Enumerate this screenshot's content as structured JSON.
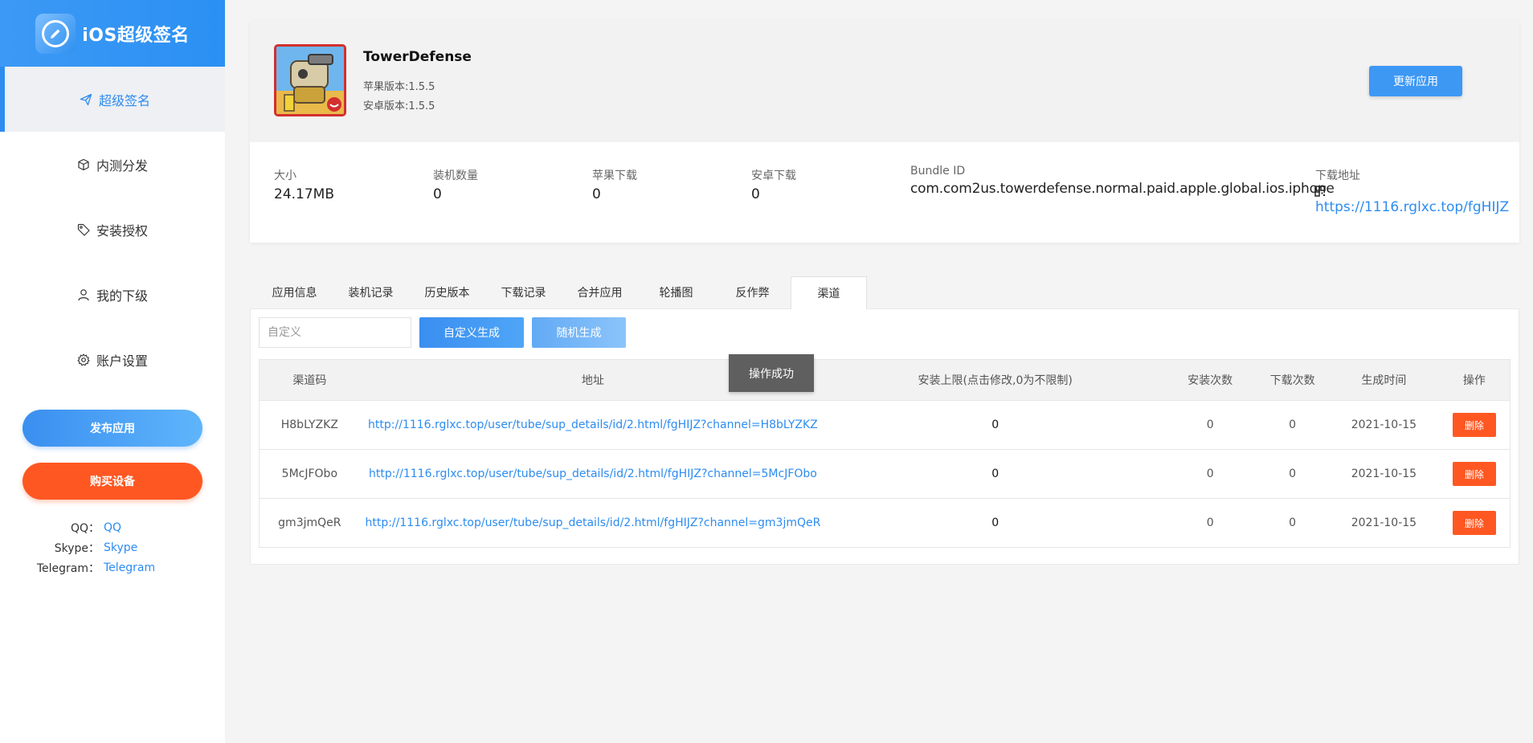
{
  "brand": {
    "title": "iOS超级签名"
  },
  "sidebar": {
    "nav": [
      {
        "label": "超级签名",
        "icon": "paper-plane-icon",
        "active": true
      },
      {
        "label": "内测分发",
        "icon": "box-icon"
      },
      {
        "label": "安装授权",
        "icon": "tag-icon"
      },
      {
        "label": "我的下级",
        "icon": "user-icon"
      },
      {
        "label": "账户设置",
        "icon": "gear-icon"
      }
    ],
    "publish_label": "发布应用",
    "buy_label": "购买设备",
    "contacts": [
      {
        "label": "QQ：",
        "value": "QQ"
      },
      {
        "label": "Skype：",
        "value": "Skype"
      },
      {
        "label": "Telegram：",
        "value": "Telegram"
      }
    ]
  },
  "app": {
    "name": "TowerDefense",
    "ios_version": "苹果版本:1.5.5",
    "android_version": "安卓版本:1.5.5",
    "update_label": "更新应用",
    "stats": {
      "size_label": "大小",
      "size": "24.17MB",
      "installs_label": "装机数量",
      "installs": "0",
      "ios_dl_label": "苹果下载",
      "ios_dl": "0",
      "android_dl_label": "安卓下载",
      "android_dl": "0",
      "bundle_label": "Bundle ID",
      "bundle": "com.com2us.towerdefense.normal.paid.apple.global.ios.iphone",
      "download_label": "下载地址",
      "download_url": "https://1116.rglxc.top/fgHIJZ"
    }
  },
  "tabs": [
    "应用信息",
    "装机记录",
    "历史版本",
    "下载记录",
    "合并应用",
    "轮播图",
    "反作弊",
    "渠道"
  ],
  "channel_panel": {
    "input_placeholder": "自定义",
    "custom_label": "自定义生成",
    "random_label": "随机生成",
    "toast": "操作成功",
    "columns": [
      "渠道码",
      "地址",
      "安装上限(点击修改,0为不限制)",
      "安装次数",
      "下载次数",
      "生成时间",
      "操作"
    ],
    "delete_label": "删除",
    "rows": [
      {
        "code": "H8bLYZKZ",
        "url": "http://1116.rglxc.top/user/tube/sup_details/id/2.html/fgHIJZ?channel=H8bLYZKZ",
        "limit": "0",
        "installs": "0",
        "downloads": "0",
        "date": "2021-10-15"
      },
      {
        "code": "5McJFObo",
        "url": "http://1116.rglxc.top/user/tube/sup_details/id/2.html/fgHIJZ?channel=5McJFObo",
        "limit": "0",
        "installs": "0",
        "downloads": "0",
        "date": "2021-10-15"
      },
      {
        "code": "gm3jmQeR",
        "url": "http://1116.rglxc.top/user/tube/sup_details/id/2.html/fgHIJZ?channel=gm3jmQeR",
        "limit": "0",
        "installs": "0",
        "downloads": "0",
        "date": "2021-10-15"
      }
    ]
  }
}
